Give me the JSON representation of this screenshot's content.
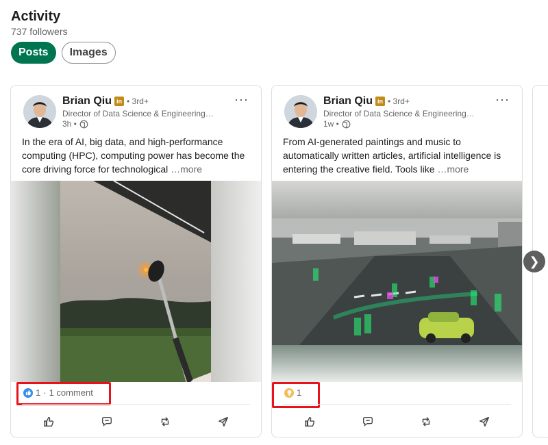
{
  "header": {
    "title": "Activity",
    "followers": "737 followers"
  },
  "tabs": [
    {
      "label": "Posts",
      "active": true
    },
    {
      "label": "Images",
      "active": false
    }
  ],
  "posts": [
    {
      "author": "Brian Qiu",
      "degree": "• 3rd+",
      "headline": "Director of Data Science & Engineering…",
      "time": "3h •",
      "text": "In the era of AI, big data, and high-performance computing (HPC), computing power has become the core driving force for technological",
      "see_more": "…more",
      "reactions_count": "1",
      "reactions_sep": "·",
      "comments": "1 comment",
      "reaction_type": "like"
    },
    {
      "author": "Brian Qiu",
      "degree": "• 3rd+",
      "headline": "Director of Data Science & Engineering…",
      "time": "1w •",
      "text": "From AI-generated paintings and music to automatically written articles, artificial intelligence is entering the creative field. Tools like",
      "see_more": "…more",
      "reactions_count": "1",
      "reaction_type": "insightful"
    }
  ],
  "colors": {
    "brand_green": "#01754f",
    "highlight_red": "#e8121b",
    "like_blue": "#378fe9",
    "insight_yellow": "#f5bb5c"
  },
  "icons": [
    "linkedin-badge-icon",
    "globe-icon",
    "more-icon",
    "like-icon",
    "comment-icon",
    "repost-icon",
    "send-icon",
    "chevron-right-icon"
  ]
}
